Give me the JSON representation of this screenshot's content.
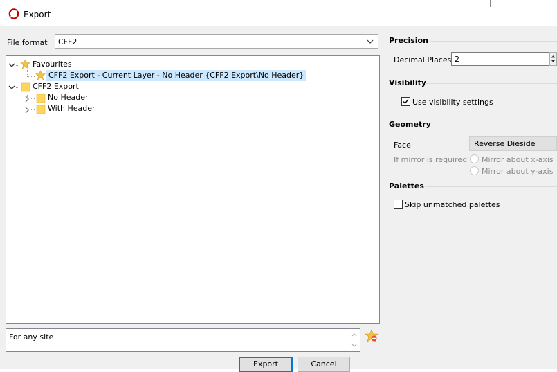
{
  "window": {
    "title": "Export"
  },
  "file_format": {
    "label": "File format",
    "value": "CFF2"
  },
  "tree": {
    "favourites": {
      "label": "Favourites",
      "items": [
        {
          "label": "CFF2 Export - Current Layer - No Header {CFF2 Export\\No Header}"
        }
      ]
    },
    "cff2_export": {
      "label": "CFF2 Export",
      "children": [
        {
          "label": "No Header"
        },
        {
          "label": "With Header"
        }
      ]
    }
  },
  "notes": {
    "value": "For any site"
  },
  "buttons": {
    "export": "Export",
    "cancel": "Cancel"
  },
  "precision": {
    "section": "Precision",
    "decimal_places_label": "Decimal Places",
    "decimal_places_value": "2"
  },
  "visibility": {
    "section": "Visibility",
    "use_visibility_label": "Use visibility settings",
    "use_visibility_checked": true
  },
  "geometry": {
    "section": "Geometry",
    "face_label": "Face",
    "face_value": "Reverse Dieside",
    "mirror_label": "If mirror is required",
    "mirror_x": "Mirror about x-axis",
    "mirror_y": "Mirror about y-axis"
  },
  "palettes": {
    "section": "Palettes",
    "skip_label": "Skip unmatched palettes",
    "skip_checked": false
  },
  "colors": {
    "accent": "#0078d7",
    "selection": "#cce8ff",
    "folder": "#ffd659",
    "logo": "#c00000"
  }
}
